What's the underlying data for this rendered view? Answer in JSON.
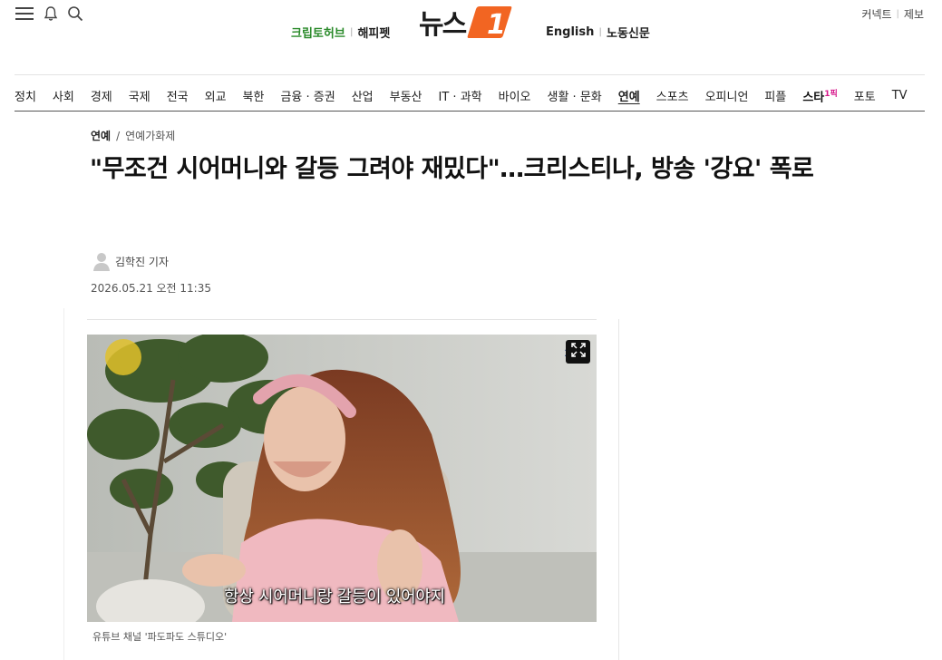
{
  "header": {
    "menu_icon": "hamburger-menu-icon",
    "bell_icon": "bell-icon",
    "search_icon": "search-icon",
    "right_links": [
      "커넥트",
      "제보"
    ],
    "left_brands": [
      "크립토허브",
      "해피펫"
    ],
    "logo_text": "뉴스",
    "logo_mark": "1",
    "right_brands": [
      "English",
      "노동신문"
    ]
  },
  "nav": {
    "items": [
      "정치",
      "사회",
      "경제",
      "국제",
      "전국",
      "외교",
      "북한",
      "금융 · 증권",
      "산업",
      "부동산",
      "IT · 과학",
      "바이오",
      "생활 · 문화",
      "연예",
      "스포츠",
      "오피니언",
      "피플",
      "포토",
      "TV"
    ],
    "active": "연예",
    "star_prefix": "스타",
    "star_suffix": "1픽"
  },
  "article": {
    "breadcrumb": [
      "연예",
      "연예가화제"
    ],
    "breadcrumb_sep": "/",
    "headline": "\"무조건 시어머니와 갈등 그려야 재밌다\"…크리스티나, 방송 '강요' 폭로",
    "reporter": "김학진 기자",
    "datetime": "2026.05.21 오전 11:35",
    "photo_subtitle": "항상 시어머니랑 갈등이 있어야지",
    "photo_caption": "유튜브 채널 '파도파도 스튜디오'"
  },
  "colors": {
    "accent_orange": "#f26522",
    "crypto_green": "#2a8a2a",
    "star_pink": "#d6168a"
  }
}
